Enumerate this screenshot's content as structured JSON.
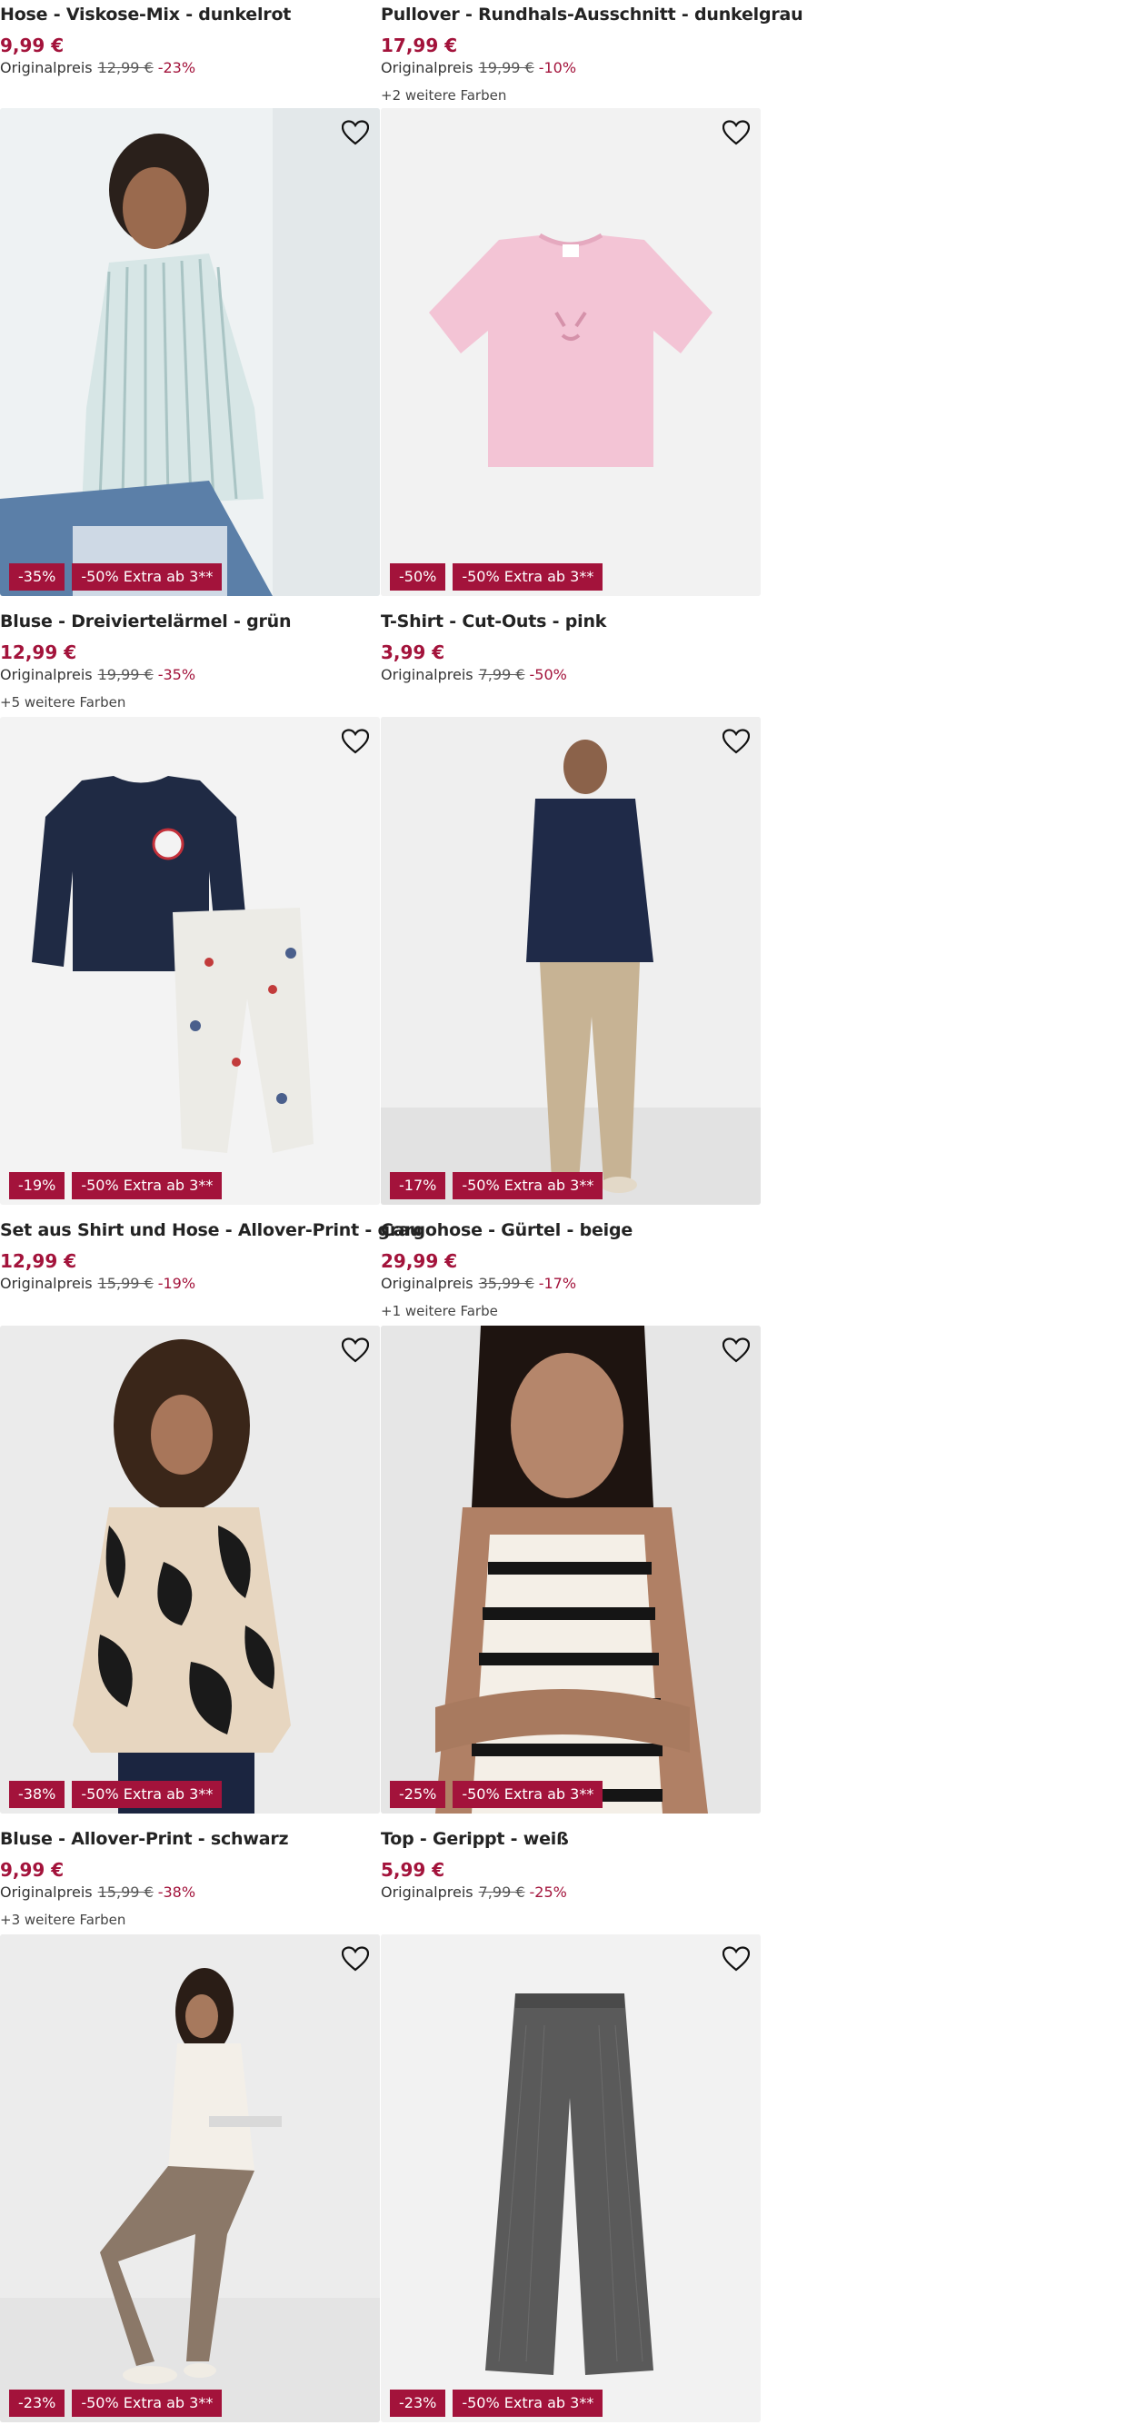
{
  "top_row": [
    {
      "name": "Hose - Viskose-Mix - dunkelrot",
      "price": "9,99 €",
      "orig_label": "Originalpreis",
      "orig_price": "12,99 €",
      "discount": "-23%",
      "more_colors": ""
    },
    {
      "name": "Pullover - Rundhals-Ausschnitt - dunkelgrau",
      "price": "17,99 €",
      "orig_label": "Originalpreis",
      "orig_price": "19,99 €",
      "discount": "-10%",
      "more_colors": "+2 weitere Farben"
    }
  ],
  "products": [
    {
      "image_icon": "woman-striped-blouse-photo",
      "badge": "-35%",
      "extra_badge": "-50% Extra ab 3**",
      "name": "Bluse - Dreiviertelärmel - grün",
      "price": "12,99 €",
      "orig_label": "Originalpreis",
      "orig_price": "19,99 €",
      "discount": "-35%",
      "more_colors": "+5 weitere Farben",
      "bg": "#e9eef0"
    },
    {
      "image_icon": "pink-tshirt-photo",
      "badge": "-50%",
      "extra_badge": "-50% Extra ab 3**",
      "name": "T-Shirt - Cut-Outs - pink",
      "price": "3,99 €",
      "orig_label": "Originalpreis",
      "orig_price": "7,99 €",
      "discount": "-50%",
      "more_colors": "",
      "bg": "#f2f2f2"
    },
    {
      "image_icon": "kids-shirt-and-pants-photo",
      "badge": "-19%",
      "extra_badge": "-50% Extra ab 3**",
      "name": "Set aus Shirt und Hose - Allover-Print - grau",
      "price": "12,99 €",
      "orig_label": "Originalpreis",
      "orig_price": "15,99 €",
      "discount": "-19%",
      "more_colors": "",
      "bg": "#f3f3f3"
    },
    {
      "image_icon": "man-cargo-pants-photo",
      "badge": "-17%",
      "extra_badge": "-50% Extra ab 3**",
      "name": "Cargohose - Gürtel - beige",
      "price": "29,99 €",
      "orig_label": "Originalpreis",
      "orig_price": "35,99 €",
      "discount": "-17%",
      "more_colors": "+1 weitere Farbe",
      "bg": "#ececec"
    },
    {
      "image_icon": "woman-print-blouse-photo",
      "badge": "-38%",
      "extra_badge": "-50% Extra ab 3**",
      "name": "Bluse - Allover-Print - schwarz",
      "price": "9,99 €",
      "orig_label": "Originalpreis",
      "orig_price": "15,99 €",
      "discount": "-38%",
      "more_colors": "+3 weitere Farben",
      "bg": "#e8e8e8"
    },
    {
      "image_icon": "woman-striped-top-photo",
      "badge": "-25%",
      "extra_badge": "-50% Extra ab 3**",
      "name": "Top - Gerippt - weiß",
      "price": "5,99 €",
      "orig_label": "Originalpreis",
      "orig_price": "7,99 €",
      "discount": "-25%",
      "more_colors": "",
      "bg": "#e4e4e4"
    },
    {
      "image_icon": "woman-leather-leggings-photo",
      "badge": "-23%",
      "extra_badge": "-50% Extra ab 3**",
      "name": "",
      "price": "",
      "orig_label": "",
      "orig_price": "",
      "discount": "",
      "more_colors": "",
      "bg": "#ebebeb"
    },
    {
      "image_icon": "grey-knit-pants-photo",
      "badge": "-23%",
      "extra_badge": "-50% Extra ab 3**",
      "name": "",
      "price": "",
      "orig_label": "",
      "orig_price": "",
      "discount": "",
      "more_colors": "",
      "bg": "#f2f2f2"
    }
  ],
  "colors": {
    "accent": "#a3133b",
    "text": "#232323"
  }
}
